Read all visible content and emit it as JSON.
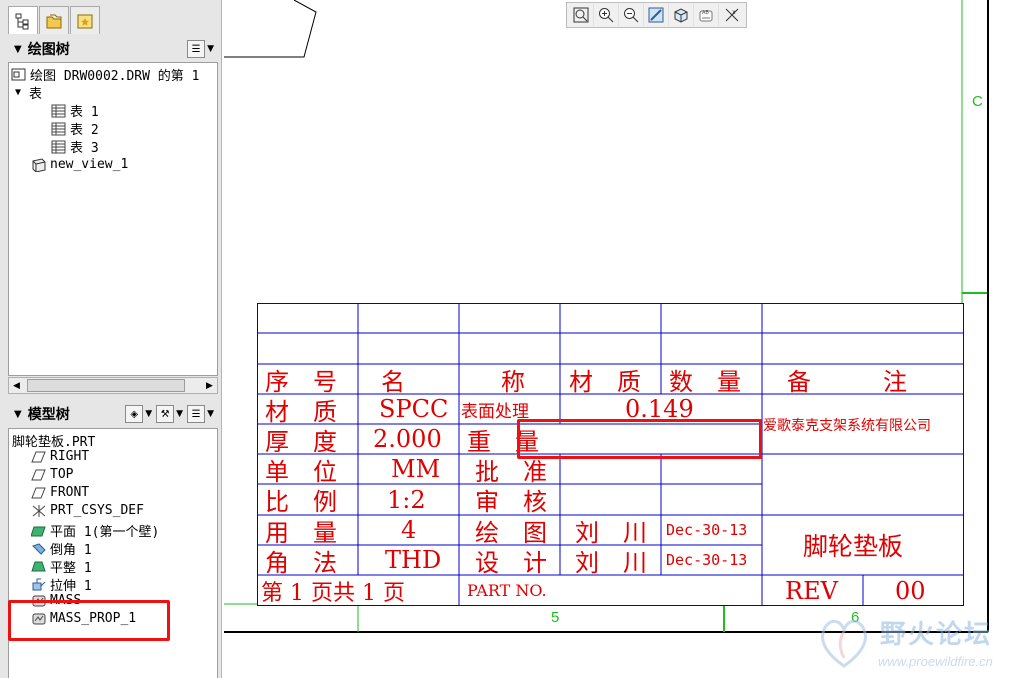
{
  "drawing_tree": {
    "title": "绘图树",
    "items": [
      {
        "label": "绘图 DRW0002.DRW 的第 1"
      },
      {
        "label": "表"
      },
      {
        "label": "表 1"
      },
      {
        "label": "表 2"
      },
      {
        "label": "表 3"
      },
      {
        "label": "new_view_1"
      }
    ]
  },
  "model_tree": {
    "title": "模型树",
    "root": "脚轮垫板.PRT",
    "items": [
      {
        "label": "RIGHT"
      },
      {
        "label": "TOP"
      },
      {
        "label": "FRONT"
      },
      {
        "label": "PRT_CSYS_DEF"
      },
      {
        "label": "平面 1(第一个壁)"
      },
      {
        "label": "倒角 1"
      },
      {
        "label": "平整 1"
      },
      {
        "label": "拉伸 1"
      },
      {
        "label": "MASS"
      },
      {
        "label": "MASS_PROP_1"
      }
    ]
  },
  "title_block": {
    "row_header": {
      "c1": "序　号",
      "c2": "名　　　　称",
      "c3": "材　质",
      "c4": "数　量",
      "c5": "备　　　注"
    },
    "material_label": "材　质",
    "material_value": "SPCC",
    "surface_label": "表面处理",
    "weight_value": "0.149",
    "company": "爱歌泰克支架系统有限公司",
    "thickness_label": "厚　度",
    "thickness_value": "2.000",
    "weight_label": "重　量",
    "unit_label": "单　位",
    "unit_value": "MM",
    "approve_label": "批　准",
    "scale_label": "比　例",
    "scale_value": "1:2",
    "review_label": "审　核",
    "qty_label": "用　量",
    "qty_value": "4",
    "draw_label": "绘　图",
    "draw_name": "刘　川",
    "draw_date": "Dec-30-13",
    "angle_label": "角　法",
    "angle_value": "THD",
    "design_label": "设　计",
    "design_name": "刘　川",
    "design_date": "Dec-30-13",
    "part_name": "脚轮垫板",
    "page_info": "第 1 页共 1 页",
    "part_no_label": "PART NO.",
    "rev_label": "REV",
    "rev_value": "00"
  },
  "zones": {
    "c": "C",
    "five": "5",
    "six": "6"
  },
  "watermark": {
    "text": "野火论坛",
    "url": "www.proewildfire.cn"
  },
  "colors": {
    "table_lines": "#0000cc",
    "text": "#e00000",
    "zone": "#22bb22",
    "highlight": "#ee1111"
  }
}
